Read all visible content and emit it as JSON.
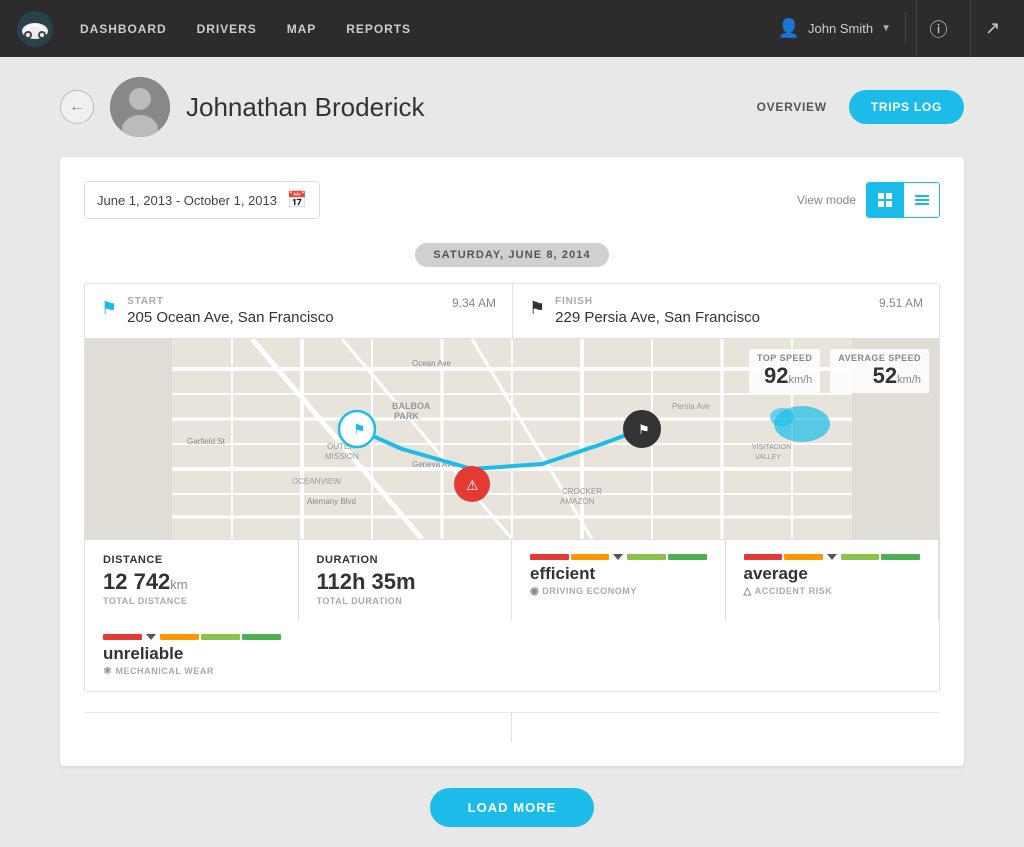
{
  "navbar": {
    "links": [
      "DASHBOARD",
      "DRIVERS",
      "MAP",
      "REPORTS"
    ],
    "user_name": "John Smith"
  },
  "profile": {
    "name": "Johnathan Broderick",
    "tab_overview": "OVERVIEW",
    "tab_trips": "TRIPS LOG"
  },
  "filters": {
    "date_range": "June 1, 2013 - October 1, 2013",
    "view_mode_label": "View mode"
  },
  "date_badge": "SATURDAY, JUNE 8, 2014",
  "trip": {
    "start_label": "START",
    "start_time": "9.34 AM",
    "start_address": "205 Ocean Ave, San Francisco",
    "finish_label": "FINISH",
    "finish_time": "9.51 AM",
    "finish_address": "229 Persia Ave, San Francisco",
    "top_speed_label": "TOP SPEED",
    "top_speed_value": "92",
    "top_speed_unit": "km/h",
    "avg_speed_label": "AVERAGE SPEED",
    "avg_speed_value": "52",
    "avg_speed_unit": "km/h",
    "distance_label": "DISTANCE",
    "distance_value": "12 742",
    "distance_unit": "km",
    "distance_sub": "TOTAL DISTANCE",
    "duration_label": "DURATION",
    "duration_value": "112h 35m",
    "duration_sub": "TOTAL DURATION",
    "economy_label": "DRIVING ECONOMY",
    "economy_word": "efficient",
    "risk_label": "ACCIDENT RISK",
    "risk_word": "average",
    "wear_label": "MECHANICAL WEAR",
    "wear_word": "unreliable"
  },
  "load_more": "LOAD MORE"
}
